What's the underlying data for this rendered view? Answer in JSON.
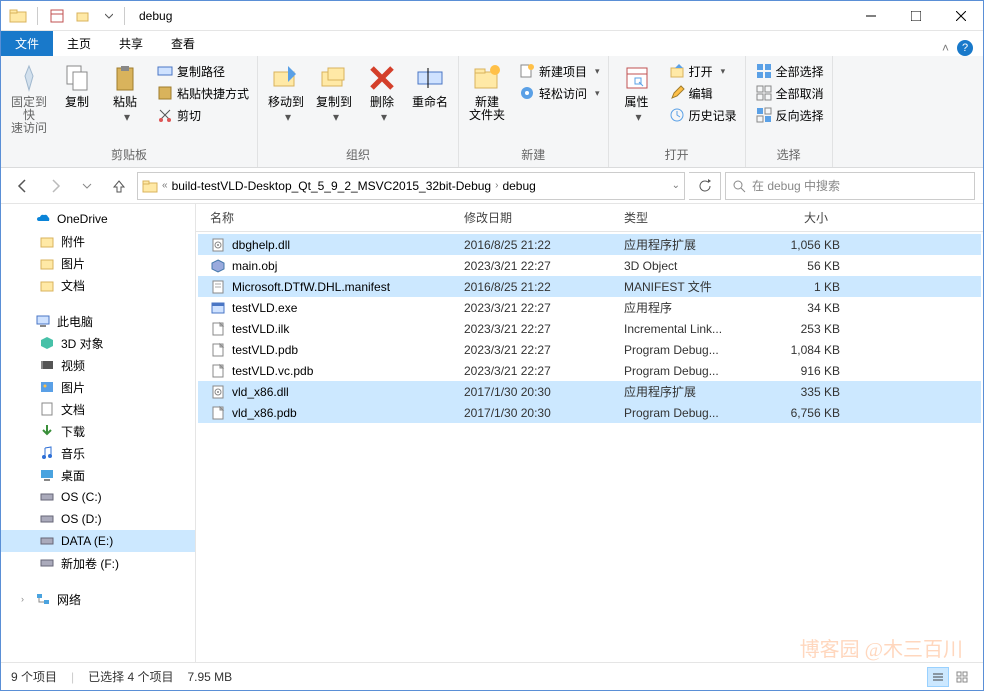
{
  "window": {
    "title": "debug"
  },
  "tabs": {
    "file": "文件",
    "home": "主页",
    "share": "共享",
    "view": "查看"
  },
  "ribbon": {
    "pin": "固定到快\n速访问",
    "copy": "复制",
    "paste": "粘贴",
    "cut": "剪切",
    "copypath": "复制路径",
    "pasteshort": "粘贴快捷方式",
    "g1": "剪贴板",
    "moveto": "移动到",
    "copyto": "复制到",
    "delete": "删除",
    "rename": "重命名",
    "g2": "组织",
    "newfolder": "新建\n文件夹",
    "newitem": "新建项目",
    "easyaccess": "轻松访问",
    "g3": "新建",
    "props": "属性",
    "open": "打开",
    "edit": "编辑",
    "history": "历史记录",
    "g4": "打开",
    "selall": "全部选择",
    "selnone": "全部取消",
    "selinv": "反向选择",
    "g5": "选择"
  },
  "breadcrumb": {
    "p1": "build-testVLD-Desktop_Qt_5_9_2_MSVC2015_32bit-Debug",
    "p2": "debug"
  },
  "search_placeholder": "在 debug 中搜索",
  "nav": {
    "onedrive": "OneDrive",
    "attach": "附件",
    "pics": "图片",
    "docs": "文档",
    "thispc": "此电脑",
    "threed": "3D 对象",
    "video": "视频",
    "pics2": "图片",
    "docs2": "文档",
    "down": "下载",
    "music": "音乐",
    "desktop": "桌面",
    "osc": "OS (C:)",
    "osd": "OS (D:)",
    "datae": "DATA (E:)",
    "newf": "新加卷 (F:)",
    "network": "网络"
  },
  "cols": {
    "name": "名称",
    "date": "修改日期",
    "type": "类型",
    "size": "大小"
  },
  "files": [
    {
      "sel": true,
      "icon": "dll",
      "name": "dbghelp.dll",
      "date": "2016/8/25 21:22",
      "type": "应用程序扩展",
      "size": "1,056 KB"
    },
    {
      "sel": false,
      "icon": "obj",
      "name": "main.obj",
      "date": "2023/3/21 22:27",
      "type": "3D Object",
      "size": "56 KB"
    },
    {
      "sel": true,
      "icon": "txt",
      "name": "Microsoft.DTfW.DHL.manifest",
      "date": "2016/8/25 21:22",
      "type": "MANIFEST 文件",
      "size": "1 KB"
    },
    {
      "sel": false,
      "icon": "exe",
      "name": "testVLD.exe",
      "date": "2023/3/21 22:27",
      "type": "应用程序",
      "size": "34 KB"
    },
    {
      "sel": false,
      "icon": "file",
      "name": "testVLD.ilk",
      "date": "2023/3/21 22:27",
      "type": "Incremental Link...",
      "size": "253 KB"
    },
    {
      "sel": false,
      "icon": "file",
      "name": "testVLD.pdb",
      "date": "2023/3/21 22:27",
      "type": "Program Debug...",
      "size": "1,084 KB"
    },
    {
      "sel": false,
      "icon": "file",
      "name": "testVLD.vc.pdb",
      "date": "2023/3/21 22:27",
      "type": "Program Debug...",
      "size": "916 KB"
    },
    {
      "sel": true,
      "icon": "dll",
      "name": "vld_x86.dll",
      "date": "2017/1/30 20:30",
      "type": "应用程序扩展",
      "size": "335 KB"
    },
    {
      "sel": true,
      "icon": "file",
      "name": "vld_x86.pdb",
      "date": "2017/1/30 20:30",
      "type": "Program Debug...",
      "size": "6,756 KB"
    }
  ],
  "status": {
    "count": "9 个项目",
    "sel": "已选择 4 个项目",
    "size": "7.95 MB"
  },
  "watermark": "博客园 @木三百川"
}
